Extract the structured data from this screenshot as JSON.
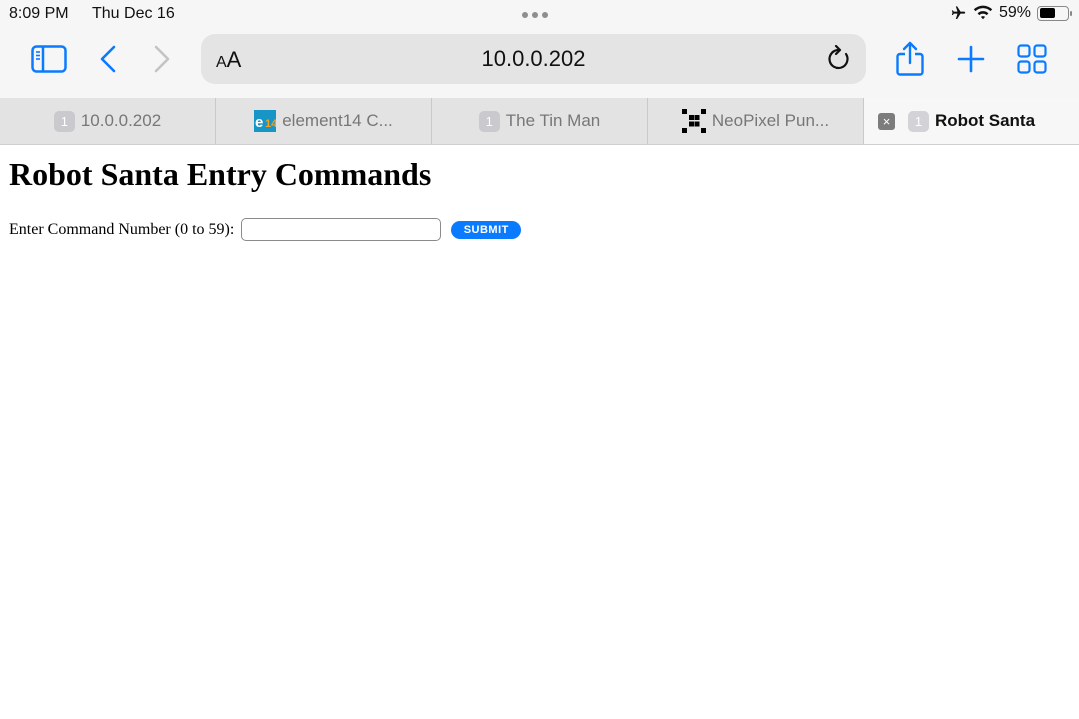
{
  "status_bar": {
    "time": "8:09 PM",
    "date": "Thu Dec 16",
    "battery_percent_label": "59%",
    "battery_level": 0.59,
    "icons": [
      "airplane-icon",
      "wifi-icon",
      "battery-icon"
    ]
  },
  "toolbar": {
    "text_size_small": "A",
    "text_size_large": "A",
    "address": "10.0.0.202",
    "accent_color": "#0a7aff"
  },
  "tabs": [
    {
      "label": "10.0.0.202",
      "badge": "1",
      "icon": "number-badge",
      "active": false
    },
    {
      "label": "element14 C...",
      "badge": "",
      "icon": "element14-favicon",
      "active": false
    },
    {
      "label": "The Tin Man",
      "badge": "1",
      "icon": "number-badge",
      "active": false
    },
    {
      "label": "NeoPixel Pun...",
      "badge": "",
      "icon": "neopixel-favicon",
      "active": false
    },
    {
      "label": "Robot Santa",
      "badge": "1",
      "icon": "number-badge",
      "active": true,
      "close": "×"
    }
  ],
  "page": {
    "title": "Robot Santa Entry Commands",
    "form": {
      "label": "Enter Command Number (0 to 59):",
      "input_value": "",
      "submit_label": "SUBMIT"
    }
  }
}
